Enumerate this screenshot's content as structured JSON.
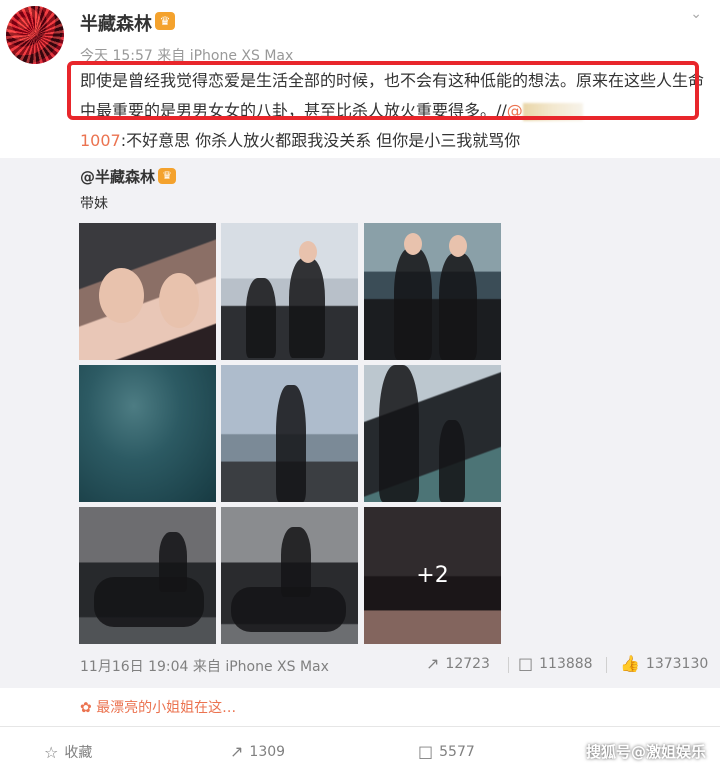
{
  "post": {
    "username": "半藏森林",
    "meta": "今天 15:57 来自 iPhone XS Max",
    "text_part1": "即使是曾经我觉得恋爱是生活全部的时候，也不会有这种低能的想法。原来在这些人生命中最重要的是男男女女的八卦，甚至比杀人放火重要得多。//",
    "mention": "@",
    "line2_num": "1007",
    "line2_text": ":不好意思 你杀人放火都跟我没关系 但你是小三我就骂你"
  },
  "repost": {
    "user": "@半藏森林",
    "text": "带妹",
    "more_count": "+2",
    "footer_time": "11月16日 19:04 来自 iPhone XS Max",
    "reposts": "12723",
    "comments": "113888",
    "likes": "1373130"
  },
  "sticky_text": "最漂亮的小姐姐在这…",
  "actions": {
    "favorite": "收藏",
    "repost_count": "1309",
    "comment_count": "5577"
  },
  "watermark": "搜狐号@激姐娱乐",
  "icons": {
    "dropdown": "chevron-down-icon",
    "repost": "repost-icon",
    "comment": "comment-icon",
    "like": "thumbs-up-icon",
    "star": "star-icon",
    "badge": "vip-badge-icon"
  },
  "colors": {
    "highlight": "#e8262b",
    "accent": "#eb7350",
    "badge": "#f4a22d"
  }
}
